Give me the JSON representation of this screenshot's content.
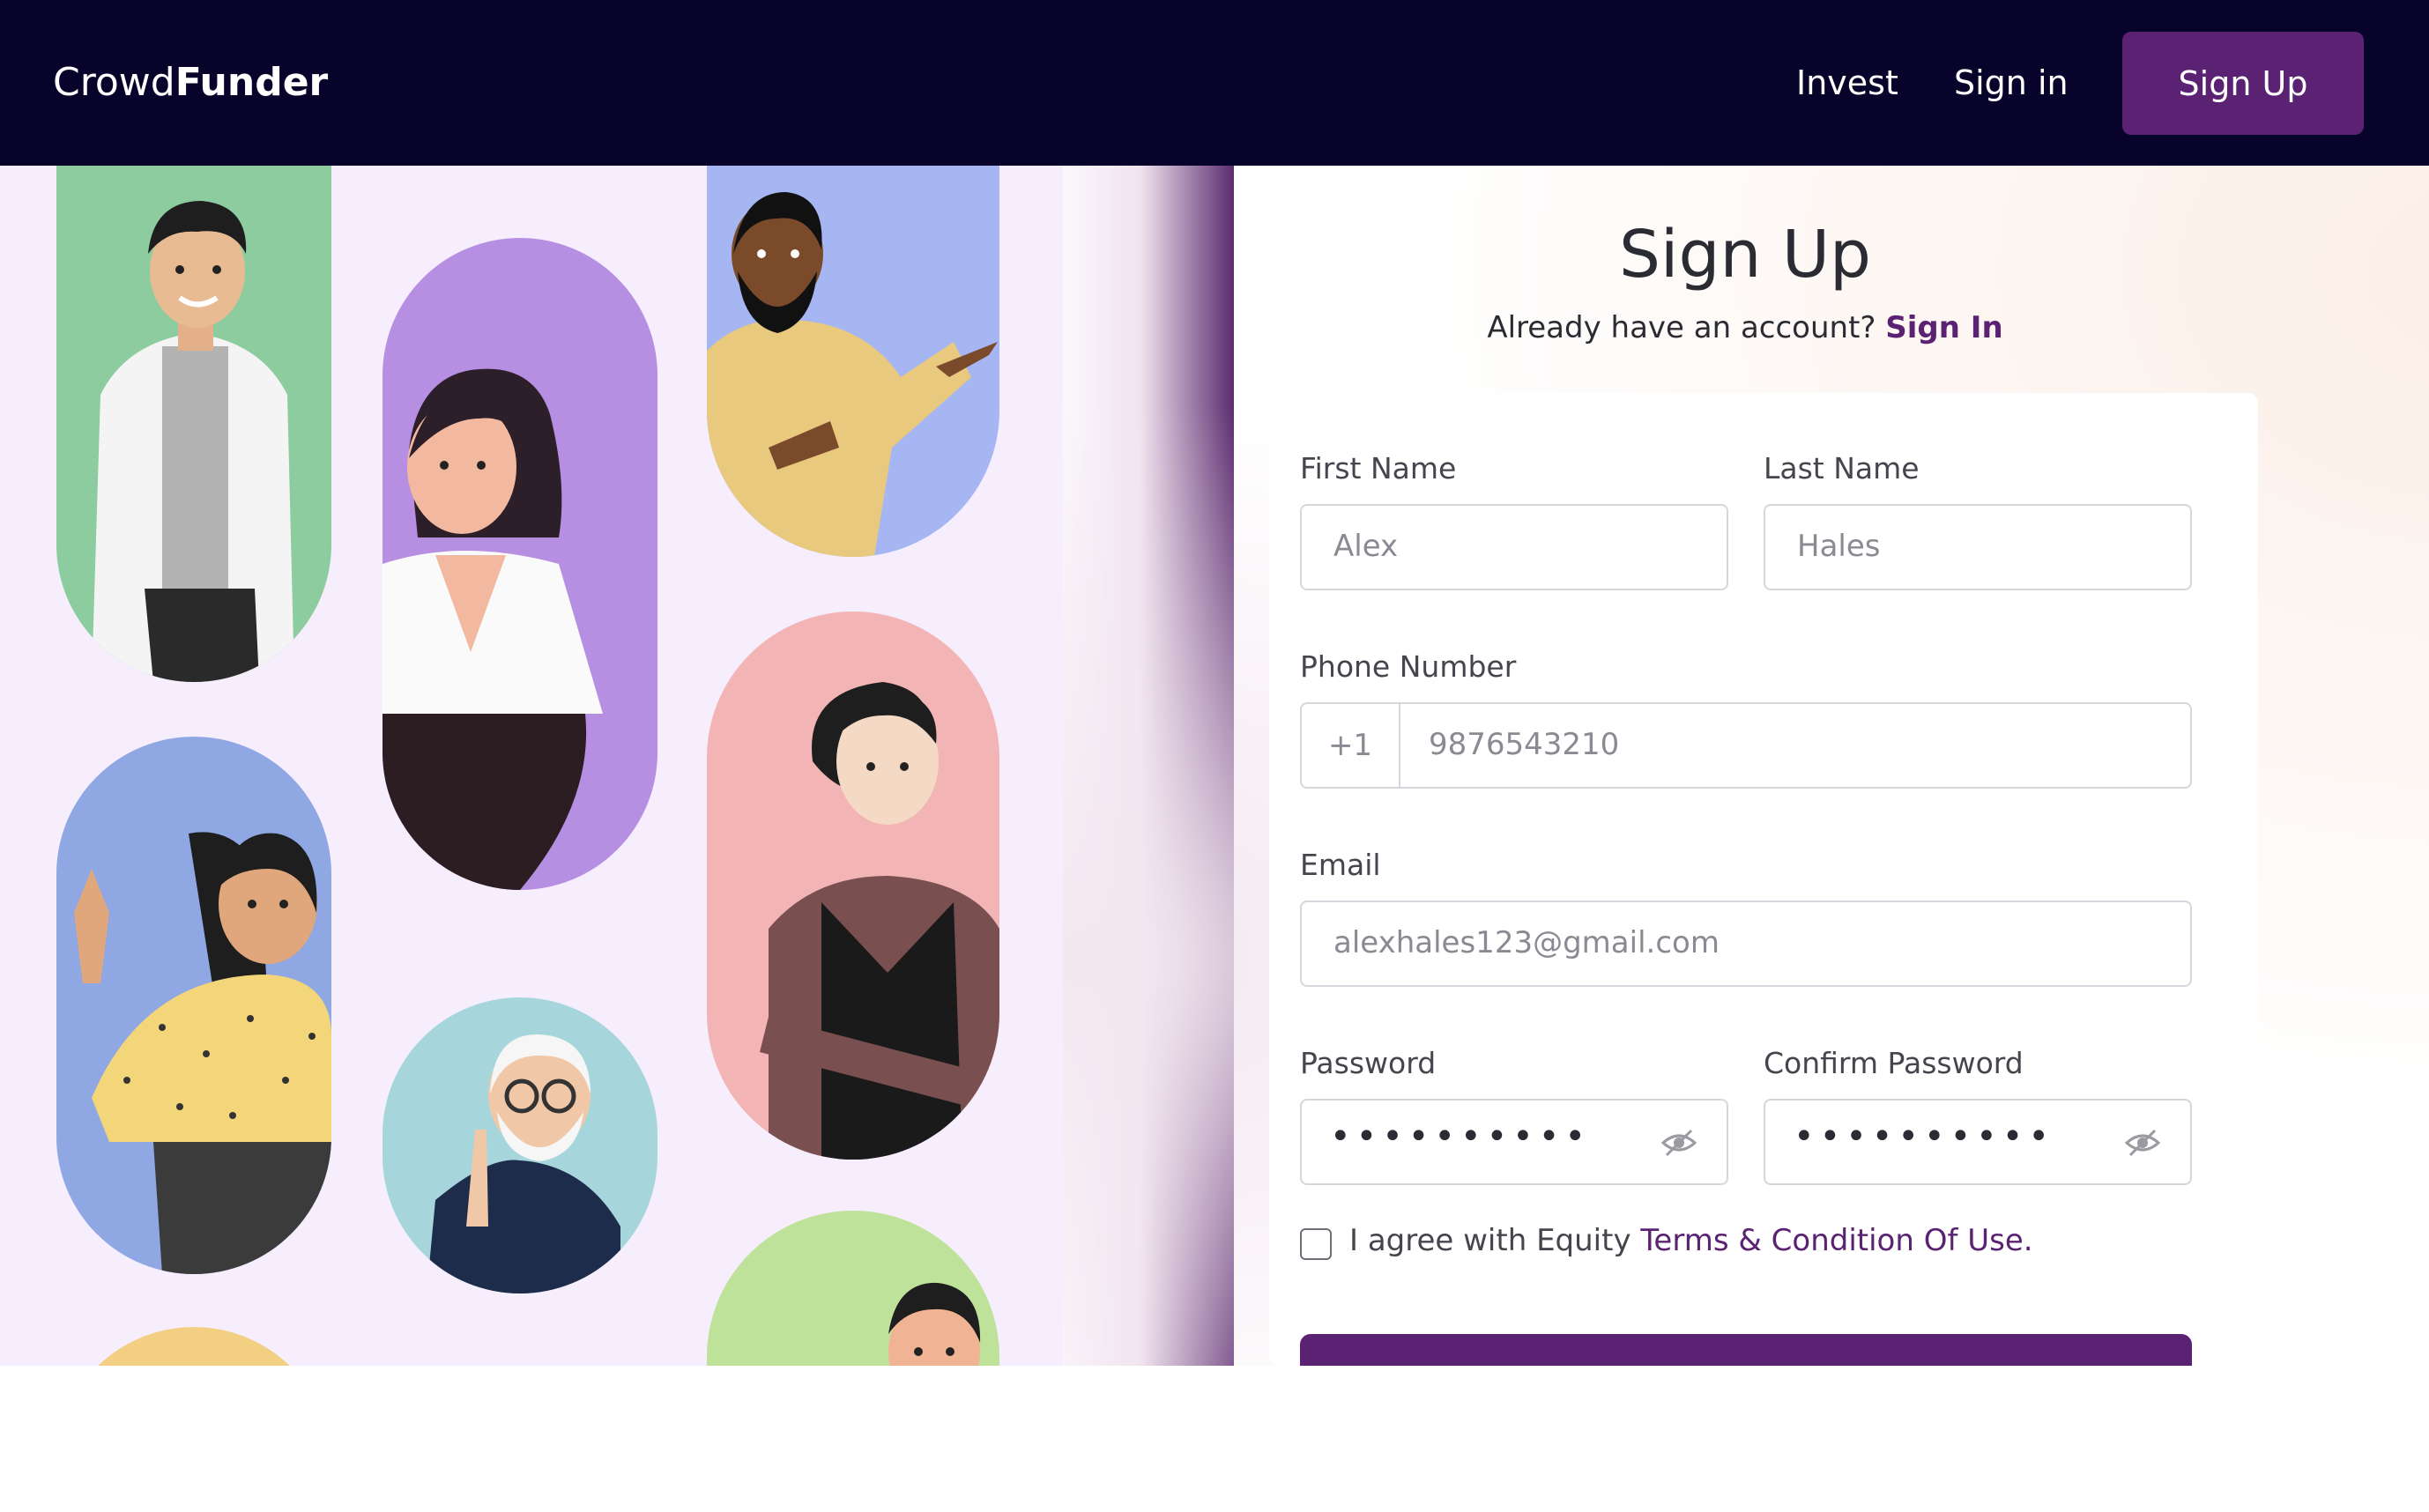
{
  "brand": {
    "logo_light": "Crowd",
    "logo_bold": "Funder"
  },
  "nav": {
    "invest": "Invest",
    "sign_in": "Sign in",
    "sign_up": "Sign Up"
  },
  "form": {
    "title": "Sign Up",
    "subtitle_text": "Already have an account?",
    "subtitle_link": "Sign In",
    "first_name": {
      "label": "First Name",
      "value": "Alex"
    },
    "last_name": {
      "label": "Last Name",
      "value": "Hales"
    },
    "phone": {
      "label": "Phone Number",
      "prefix": "+1",
      "value": "9876543210"
    },
    "email": {
      "label": "Email",
      "value": "alexhales123@gmail.com"
    },
    "password": {
      "label": "Password",
      "masked": "••••••••••"
    },
    "confirm_password": {
      "label": "Confirm Password",
      "masked": "••••••••••"
    },
    "agree_text": "I agree with Equity",
    "agree_link": "Terms & Condition Of Use.",
    "agree_checked": false
  },
  "colors": {
    "nav_bg": "#07032a",
    "accent": "#5b2173",
    "panel_bg": "#f6edfd"
  },
  "icons": {
    "password_toggle": "eye-slash-icon",
    "confirm_toggle": "eye-slash-icon"
  },
  "illustrations": [
    "person-man-white-jacket",
    "person-woman-white-blouse",
    "person-man-beard-pointing",
    "person-woman-polka-dot",
    "person-old-man-glasses",
    "person-woman-black-dress",
    "person-man-green-circle"
  ]
}
